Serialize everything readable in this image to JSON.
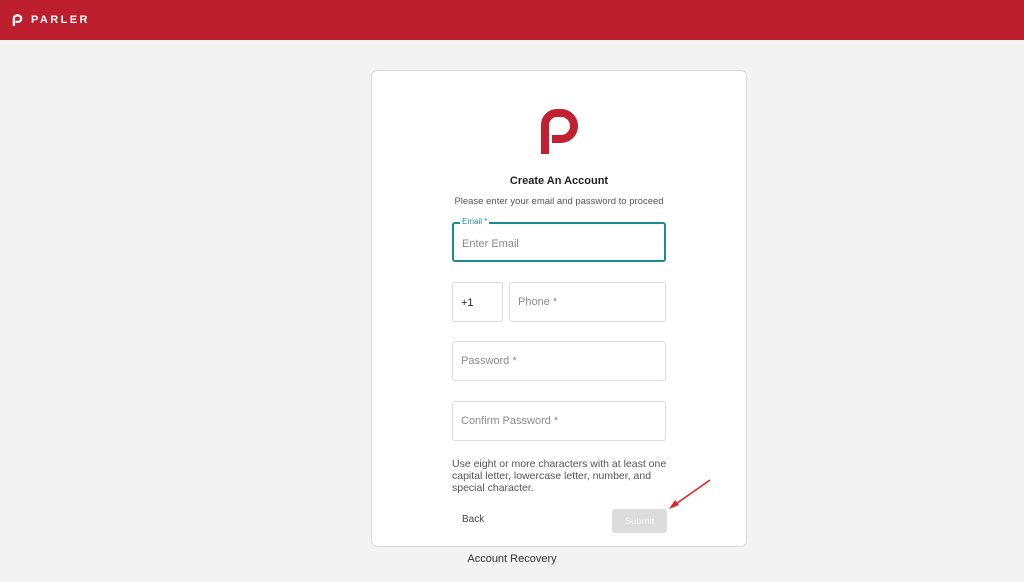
{
  "header": {
    "brand_name": "PARLER",
    "background_color": "#bd1e2d"
  },
  "card": {
    "logo_icon": "parler-p-logo-icon",
    "title": "Create An Account",
    "subtitle": "Please enter your email and password to proceed",
    "fields": {
      "email": {
        "label": "Email *",
        "placeholder": "Enter Email",
        "value": ""
      },
      "country_code": {
        "value": "+1"
      },
      "phone": {
        "placeholder": "Phone *",
        "value": ""
      },
      "password": {
        "placeholder": "Password *",
        "value": ""
      },
      "confirm_password": {
        "placeholder": "Confirm Password *",
        "value": ""
      }
    },
    "hint": "Use eight or more characters with at least one capital letter, lowercase letter, number, and special character.",
    "back_label": "Back",
    "submit_label": "Submit"
  },
  "annotation": {
    "arrow_icon": "red-arrow-icon",
    "arrow_color": "#e02424"
  },
  "footer": {
    "recovery_label": "Account Recovery"
  },
  "colors": {
    "accent": "#1f8a8f",
    "brand": "#bd1e2d"
  }
}
